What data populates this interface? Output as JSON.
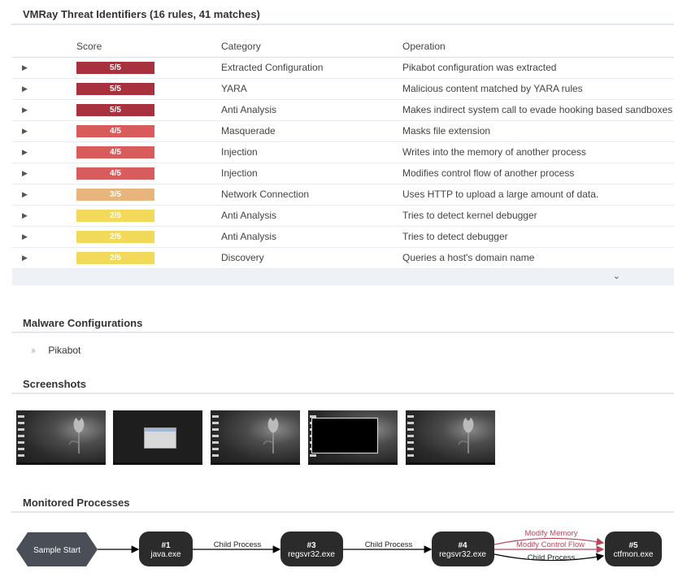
{
  "threat_identifiers": {
    "title": "VMRay Threat Identifiers (16 rules, 41 matches)",
    "headers": {
      "score": "Score",
      "category": "Category",
      "operation": "Operation"
    },
    "rows": [
      {
        "score": "5/5",
        "color": "#a8313f",
        "category": "Extracted Configuration",
        "operation": "Pikabot configuration was extracted"
      },
      {
        "score": "5/5",
        "color": "#a8313f",
        "category": "YARA",
        "operation": "Malicious content matched by YARA rules"
      },
      {
        "score": "5/5",
        "color": "#a8313f",
        "category": "Anti Analysis",
        "operation": "Makes indirect system call to evade hooking based sandboxes"
      },
      {
        "score": "4/5",
        "color": "#d95c5c",
        "category": "Masquerade",
        "operation": "Masks file extension"
      },
      {
        "score": "4/5",
        "color": "#d95c5c",
        "category": "Injection",
        "operation": "Writes into the memory of another process"
      },
      {
        "score": "4/5",
        "color": "#d95c5c",
        "category": "Injection",
        "operation": "Modifies control flow of another process"
      },
      {
        "score": "3/5",
        "color": "#e8b57d",
        "category": "Network Connection",
        "operation": "Uses HTTP to upload a large amount of data."
      },
      {
        "score": "2/5",
        "color": "#f3d95a",
        "category": "Anti Analysis",
        "operation": "Tries to detect kernel debugger"
      },
      {
        "score": "2/5",
        "color": "#f3d95a",
        "category": "Anti Analysis",
        "operation": "Tries to detect debugger"
      },
      {
        "score": "2/5",
        "color": "#f3d95a",
        "category": "Discovery",
        "operation": "Queries a host's domain name"
      }
    ]
  },
  "malware_configurations": {
    "title": "Malware Configurations",
    "items": [
      "Pikabot"
    ]
  },
  "screenshots": {
    "title": "Screenshots",
    "items": [
      "desktop",
      "dialog",
      "desktop",
      "console",
      "desktop"
    ]
  },
  "monitored_processes": {
    "title": "Monitored Processes",
    "start_label": "Sample Start",
    "nodes": [
      {
        "id": "#1",
        "name": "java.exe"
      },
      {
        "id": "#3",
        "name": "regsvr32.exe"
      },
      {
        "id": "#4",
        "name": "regsvr32.exe"
      },
      {
        "id": "#5",
        "name": "ctfmon.exe"
      }
    ],
    "edges": {
      "child_process": "Child Process",
      "modify_memory": "Modify Memory",
      "modify_control_flow": "Modify Control Flow"
    },
    "colors": {
      "node": "#2b2b2b",
      "start": "#4a4f57",
      "highlight_edge": "#b5475a"
    }
  }
}
